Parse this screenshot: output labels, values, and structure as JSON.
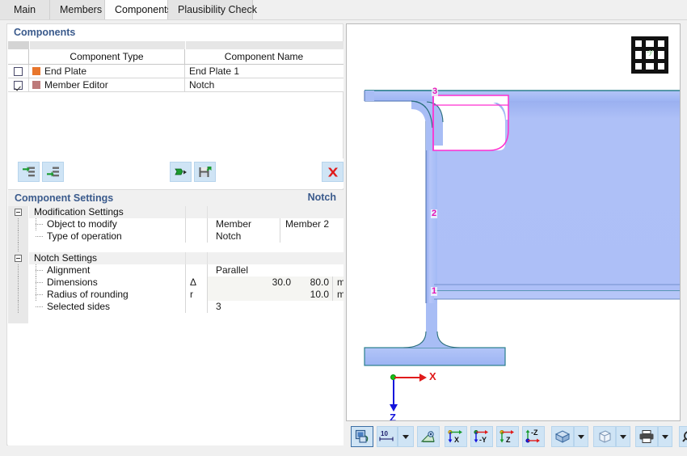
{
  "tabs": [
    {
      "label": "Main",
      "active": false
    },
    {
      "label": "Members",
      "active": false
    },
    {
      "label": "Components",
      "active": true
    },
    {
      "label": "Plausibility Check",
      "active": false
    }
  ],
  "components_panel": {
    "title": "Components",
    "columns": [
      "",
      "Component Type",
      "Component Name"
    ],
    "rows": [
      {
        "checked": false,
        "color": "#e8762c",
        "type": "End Plate",
        "name": "End Plate 1"
      },
      {
        "checked": true,
        "color": "#bd7a7a",
        "type": "Member Editor",
        "name": "Notch"
      }
    ],
    "toolbar": {
      "insert_above": "insert-row-above",
      "insert_below": "insert-row-below",
      "import": "import-component",
      "save": "save-component",
      "delete": "delete-component"
    }
  },
  "settings_panel": {
    "title": "Component Settings",
    "title_right": "Notch",
    "groups": [
      {
        "name": "Modification Settings",
        "rows": [
          {
            "label": "Object to modify",
            "symbol": "",
            "value": "Member",
            "value2": "Member 2",
            "unit": "",
            "kind": "two"
          },
          {
            "label": "Type of operation",
            "symbol": "",
            "value": "Notch",
            "value2": "",
            "unit": "",
            "kind": "two"
          }
        ]
      },
      {
        "name": "Notch Settings",
        "rows": [
          {
            "label": "Alignment",
            "symbol": "",
            "value": "Parallel",
            "unit": "",
            "kind": "text"
          },
          {
            "label": "Dimensions",
            "symbol": "Δ",
            "value": "30.0",
            "value2": "80.0",
            "unit": "mm",
            "kind": "num2"
          },
          {
            "label": "Radius of rounding",
            "symbol": "r",
            "value": "",
            "value2": "10.0",
            "unit": "mm",
            "kind": "num2"
          },
          {
            "label": "Selected sides",
            "symbol": "",
            "value": "3",
            "unit": "",
            "kind": "text"
          }
        ]
      }
    ]
  },
  "viewport": {
    "navcube_label": "-y",
    "axis_x_label": "X",
    "axis_z_label": "Z",
    "node_labels": [
      "1",
      "2",
      "3"
    ],
    "colors": {
      "beam_fill": "#a8bdf5",
      "beam_edge": "#2a7f8c",
      "notch_outline": "#ff2fd0",
      "axis_x": "#e01b1b",
      "axis_z": "#1414dc",
      "origin": "#17c217"
    }
  },
  "bottom_toolbar": {
    "buttons": [
      {
        "name": "render-toggle",
        "label": ""
      },
      {
        "name": "grid-spacing",
        "label": "10"
      },
      {
        "name": "measure",
        "label": ""
      },
      {
        "name": "view-x",
        "label": "X"
      },
      {
        "name": "view-minus-y",
        "label": "-Y"
      },
      {
        "name": "view-z",
        "label": "Z"
      },
      {
        "name": "view-minus-z",
        "label": "-Z"
      },
      {
        "name": "display-mode",
        "label": ""
      },
      {
        "name": "wireframe-mode",
        "label": ""
      },
      {
        "name": "print",
        "label": ""
      },
      {
        "name": "reset-zoom",
        "label": ""
      },
      {
        "name": "panel-toggle",
        "label": ""
      }
    ]
  }
}
